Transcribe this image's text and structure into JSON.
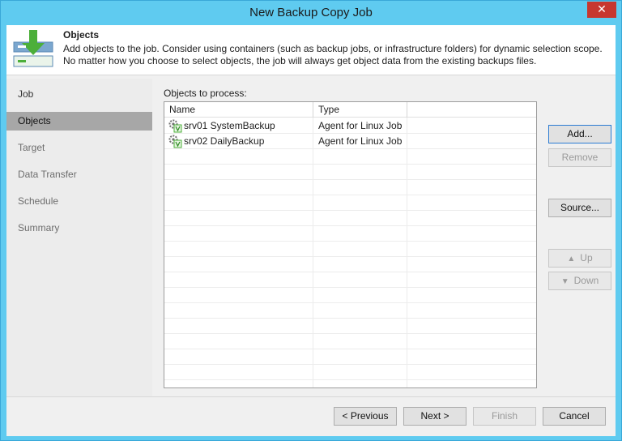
{
  "window": {
    "title": "New Backup Copy Job",
    "close_glyph": "✕"
  },
  "header": {
    "title": "Objects",
    "description": "Add objects to the job. Consider using containers (such as backup jobs, or infrastructure folders) for dynamic selection scope. No matter how you choose to select objects, the job will always get object data from the existing backups files.",
    "icon": "backup-copy-download-icon"
  },
  "nav": {
    "items": [
      {
        "label": "Job"
      },
      {
        "label": "Objects"
      },
      {
        "label": "Target"
      },
      {
        "label": "Data Transfer"
      },
      {
        "label": "Schedule"
      },
      {
        "label": "Summary"
      }
    ],
    "active": "Objects"
  },
  "objects": {
    "label": "Objects to process:",
    "columns": [
      "Name",
      "Type"
    ],
    "rows": [
      {
        "name": "srv01 SystemBackup",
        "type": "Agent for Linux Job",
        "icon": "linux-agent-job-icon"
      },
      {
        "name": "srv02 DailyBackup",
        "type": "Agent for Linux Job",
        "icon": "linux-agent-job-icon"
      }
    ]
  },
  "side_buttons": {
    "add": "Add...",
    "remove": "Remove",
    "source": "Source...",
    "up": "Up",
    "down": "Down"
  },
  "footer": {
    "previous": "< Previous",
    "next": "Next >",
    "finish": "Finish",
    "cancel": "Cancel"
  },
  "colors": {
    "titlebar": "#5fcbf0",
    "close": "#c7372f",
    "active_nav": "#a7a7a7",
    "accent_green": "#4caf3a"
  }
}
